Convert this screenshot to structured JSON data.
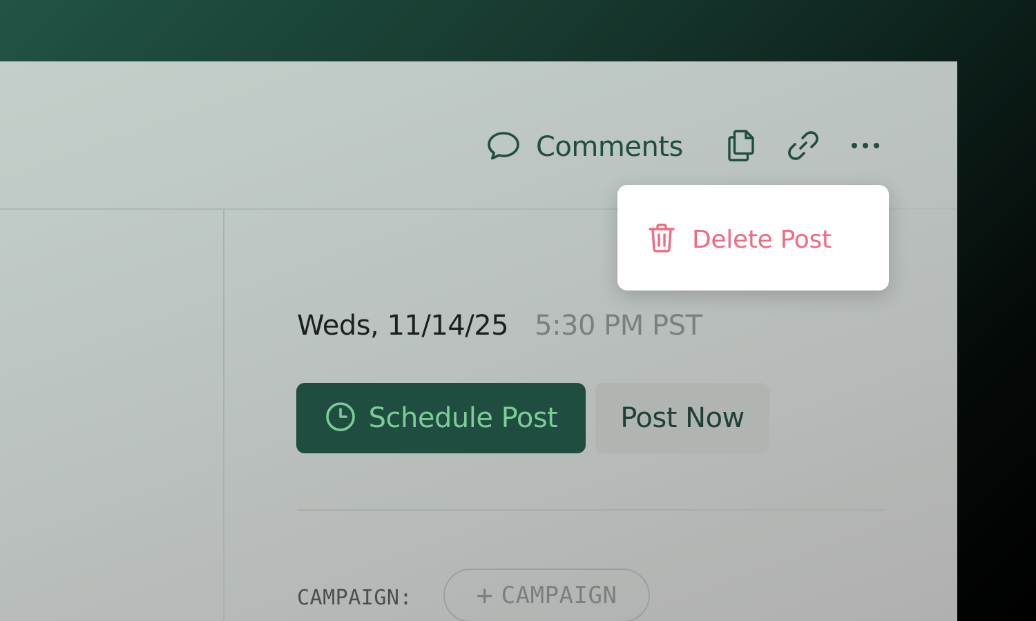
{
  "toolbar": {
    "comments_label": "Comments",
    "comments_icon": "speech-bubble-icon",
    "copy_icon": "copy-icon",
    "link_icon": "link-icon",
    "more_icon": "more-horizontal-icon"
  },
  "menu": {
    "items": [
      {
        "label": "Delete Post",
        "icon": "trash-icon",
        "color": "#f06a82"
      }
    ]
  },
  "schedule": {
    "date": "Weds, 11/14/25",
    "time": "5:30 PM PST",
    "schedule_button_label": "Schedule Post",
    "schedule_icon": "clock-icon",
    "post_now_label": "Post Now"
  },
  "campaign": {
    "label": "CAMPAIGN:",
    "add_plus": "+",
    "add_label": "CAMPAIGN"
  },
  "colors": {
    "accent": "#1f4d40",
    "accent_text": "#7ecb9a",
    "danger": "#f06a82"
  }
}
